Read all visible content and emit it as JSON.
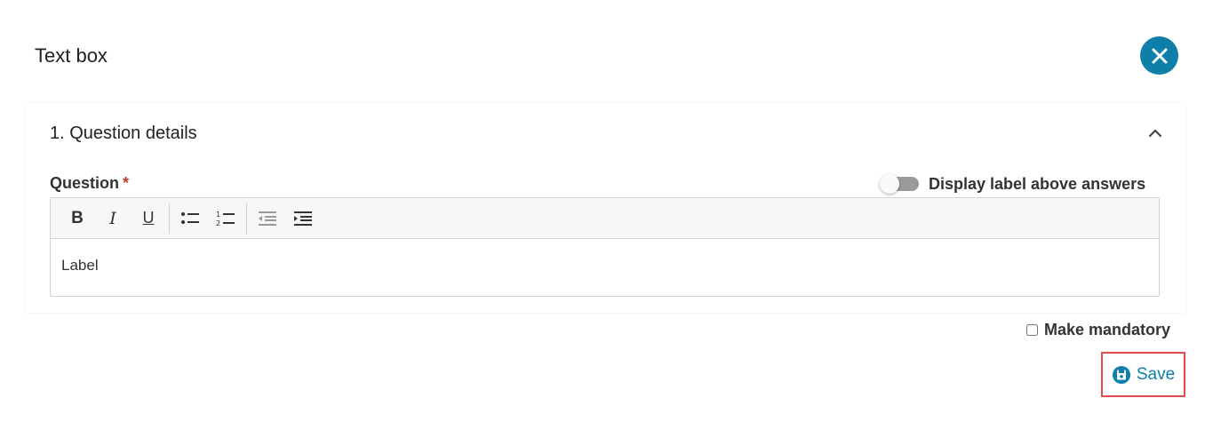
{
  "dialog": {
    "title": "Text box",
    "close_icon": "close-icon"
  },
  "section": {
    "title": "1. Question details",
    "collapse_icon": "chevron-up-icon"
  },
  "question": {
    "label": "Question",
    "required_marker": "*",
    "toggle_label": "Display label above answers",
    "toggle_on": false
  },
  "toolbar": {
    "bold": "B",
    "italic": "I",
    "underline": "U",
    "icons": [
      "bold-icon",
      "italic-icon",
      "underline-icon",
      "bulleted-list-icon",
      "numbered-list-icon",
      "outdent-icon",
      "indent-icon"
    ]
  },
  "editor": {
    "content": "Label"
  },
  "footer": {
    "mandatory_label": "Make mandatory",
    "mandatory_checked": false,
    "save_label": "Save",
    "save_icon": "save-icon"
  },
  "colors": {
    "accent": "#0e7fa8",
    "required": "#c0392b",
    "highlight_border": "#e04b4b"
  }
}
